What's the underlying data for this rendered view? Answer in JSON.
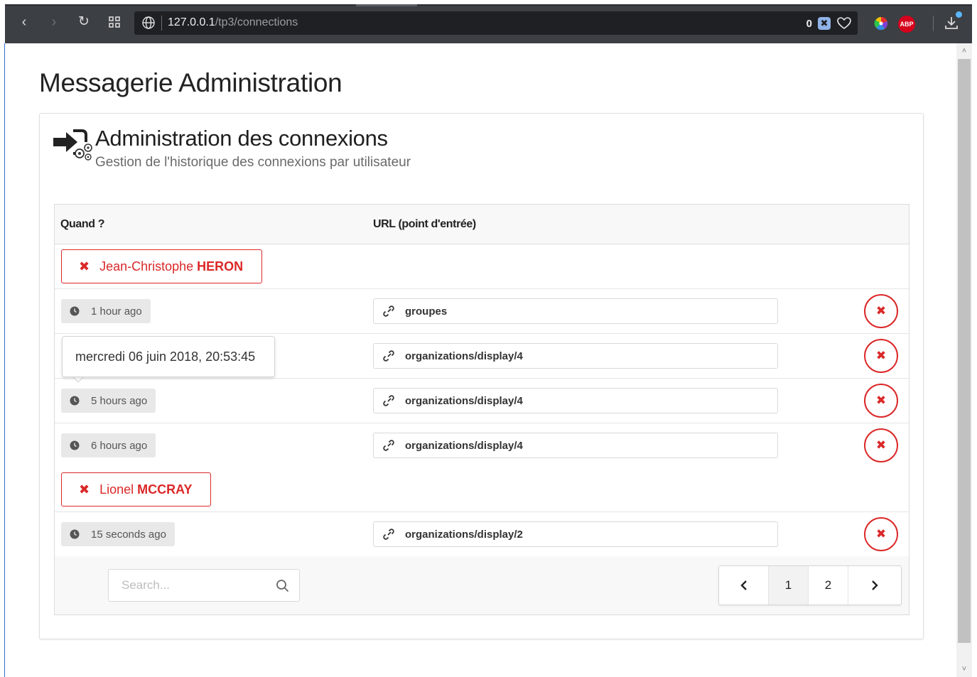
{
  "browser": {
    "url_host": "127.0.0.1",
    "url_path": "/tp3/connections",
    "shield_count": "0",
    "abp_label": "ABP"
  },
  "page": {
    "title": "Messagerie Administration"
  },
  "header": {
    "title": "Administration des connexions",
    "subtitle": "Gestion de l'historique des connexions par utilisateur"
  },
  "table": {
    "col_when": "Quand ?",
    "col_url": "URL (point d'entrée)",
    "groups": [
      {
        "first_name": "Jean-Christophe",
        "last_name": "HERON",
        "rows": [
          {
            "time": "1 hour ago",
            "url": "groupes"
          },
          {
            "time": "",
            "url": "organizations/display/4"
          },
          {
            "time": "5 hours ago",
            "url": "organizations/display/4"
          },
          {
            "time": "6 hours ago",
            "url": "organizations/display/4"
          }
        ]
      },
      {
        "first_name": "Lionel",
        "last_name": "MCCRAY",
        "rows": [
          {
            "time": "15 seconds ago",
            "url": "organizations/display/2"
          }
        ]
      }
    ]
  },
  "tooltip": {
    "text": "mercredi 06 juin 2018, 20:53:45"
  },
  "search": {
    "placeholder": "Search..."
  },
  "pagination": {
    "prev": "‹",
    "pages": [
      "1",
      "2"
    ],
    "next": "›",
    "active": "1"
  },
  "icons": {
    "delete": "✖",
    "user_remove": "✖"
  },
  "colors": {
    "danger": "#db2828",
    "chrome": "#3c3f43",
    "label_bg": "#e8e8e8"
  }
}
